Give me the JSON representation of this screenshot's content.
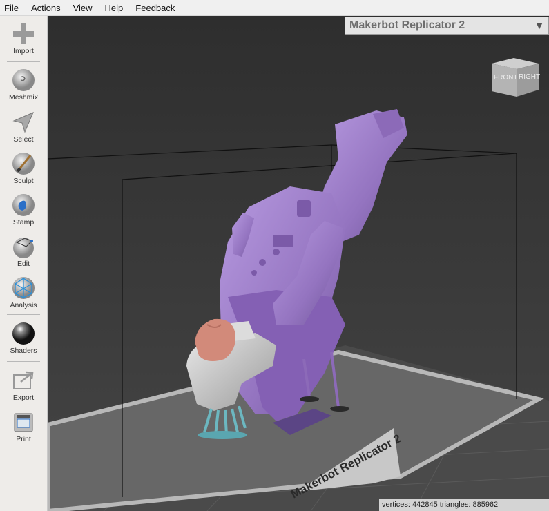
{
  "menu": [
    "File",
    "Actions",
    "View",
    "Help",
    "Feedback"
  ],
  "tools": {
    "import": "Import",
    "meshmix": "Meshmix",
    "select": "Select",
    "sculpt": "Sculpt",
    "stamp": "Stamp",
    "edit": "Edit",
    "analysis": "Analysis",
    "shaders": "Shaders",
    "export": "Export",
    "print": "Print"
  },
  "printer": {
    "selected": "Makerbot Replicator 2",
    "bed_label": "Makerbot Replicator 2"
  },
  "viewcube": {
    "front": "FRONT",
    "right": "RIGHT"
  },
  "status": "vertices: 442845 triangles: 885962",
  "colors": {
    "model": "#9b7fc4",
    "head": "#d28a7a",
    "supports": "#6cb7c0",
    "suit": "#c8c8c8",
    "background": "#3b3b3b"
  }
}
